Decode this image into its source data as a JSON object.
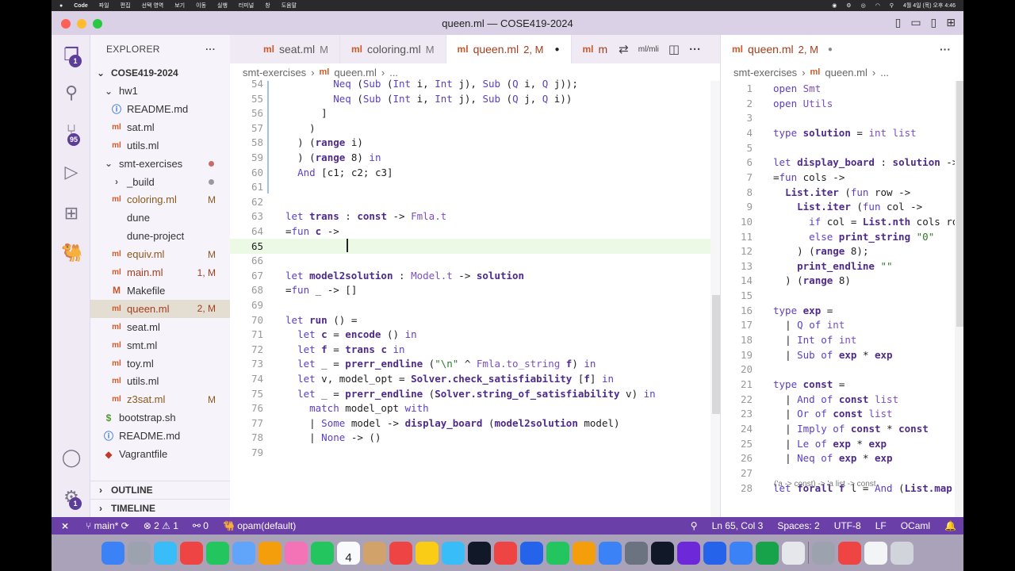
{
  "mac_menu": {
    "app": "Code",
    "items": [
      "파일",
      "편집",
      "선택 영역",
      "보기",
      "이동",
      "실행",
      "터미널",
      "창",
      "도움말"
    ],
    "clock": "4월 4일 (목) 오후 4:46"
  },
  "window": {
    "title": "queen.ml — COSE419-2024"
  },
  "activity": {
    "explorer_badge": "1",
    "scm_badge": "95",
    "settings_badge": "1"
  },
  "sidebar": {
    "header": "EXPLORER",
    "root": "COSE419-2024",
    "outline": "OUTLINE",
    "timeline": "TIMELINE",
    "items": [
      {
        "label": "hw1",
        "icon": "⌄",
        "status": ""
      },
      {
        "label": "README.md",
        "icon": "ⓘ",
        "status": ""
      },
      {
        "label": "sat.ml",
        "icon": "ml",
        "status": ""
      },
      {
        "label": "utils.ml",
        "icon": "ml",
        "status": ""
      },
      {
        "label": "smt-exercises",
        "icon": "⌄",
        "status": "dot"
      },
      {
        "label": "_build",
        "icon": "›",
        "status": "dot"
      },
      {
        "label": "coloring.ml",
        "icon": "ml",
        "status": "M"
      },
      {
        "label": "dune",
        "icon": "",
        "status": ""
      },
      {
        "label": "dune-project",
        "icon": "",
        "status": ""
      },
      {
        "label": "equiv.ml",
        "icon": "ml",
        "status": "M"
      },
      {
        "label": "main.ml",
        "icon": "ml",
        "status": "1, M"
      },
      {
        "label": "Makefile",
        "icon": "M",
        "status": ""
      },
      {
        "label": "queen.ml",
        "icon": "ml",
        "status": "2, M"
      },
      {
        "label": "seat.ml",
        "icon": "ml",
        "status": ""
      },
      {
        "label": "smt.ml",
        "icon": "ml",
        "status": ""
      },
      {
        "label": "toy.ml",
        "icon": "ml",
        "status": ""
      },
      {
        "label": "utils.ml",
        "icon": "ml",
        "status": ""
      },
      {
        "label": "z3sat.ml",
        "icon": "ml",
        "status": "M"
      },
      {
        "label": "bootstrap.sh",
        "icon": "$",
        "status": ""
      },
      {
        "label": "README.md",
        "icon": "ⓘ",
        "status": ""
      },
      {
        "label": "Vagrantfile",
        "icon": "◆",
        "status": ""
      }
    ]
  },
  "editor1": {
    "tabs": [
      {
        "label": "seat.ml",
        "mod": "M"
      },
      {
        "label": "coloring.ml",
        "mod": "M"
      },
      {
        "label": "queen.ml",
        "mod": "2, M"
      },
      {
        "label": "m",
        "mod": ""
      }
    ],
    "breadcrumb": [
      "smt-exercises",
      "queen.ml",
      "..."
    ],
    "lines": [
      {
        "n": "54",
        "t": "        Neq (Sub (Int i, Int j), Sub (Q i, Q j));"
      },
      {
        "n": "55",
        "t": "        Neq (Sub (Int i, Int j), Sub (Q j, Q i))"
      },
      {
        "n": "56",
        "t": "      ]"
      },
      {
        "n": "57",
        "t": "    )"
      },
      {
        "n": "58",
        "t": "  ) (range i)"
      },
      {
        "n": "59",
        "t": "  ) (range 8) in"
      },
      {
        "n": "60",
        "t": "  And [c1; c2; c3]"
      },
      {
        "n": "61",
        "t": ""
      },
      {
        "n": "62",
        "t": ""
      },
      {
        "n": "63",
        "t": "let trans : const -> Fmla.t"
      },
      {
        "n": "64",
        "t": "=fun c ->"
      },
      {
        "n": "65",
        "t": ""
      },
      {
        "n": "66",
        "t": ""
      },
      {
        "n": "67",
        "t": "let model2solution : Model.t -> solution"
      },
      {
        "n": "68",
        "t": "=fun _ -> []"
      },
      {
        "n": "69",
        "t": ""
      },
      {
        "n": "70",
        "t": "let run () ="
      },
      {
        "n": "71",
        "t": "  let c = encode () in"
      },
      {
        "n": "72",
        "t": "  let f = trans c in"
      },
      {
        "n": "73",
        "t": "  let _ = prerr_endline (\"\\n\" ^ Fmla.to_string f) in"
      },
      {
        "n": "74",
        "t": "  let v, model_opt = Solver.check_satisfiability [f] in"
      },
      {
        "n": "75",
        "t": "  let _ = prerr_endline (Solver.string_of_satisfiability v) in"
      },
      {
        "n": "76",
        "t": "    match model_opt with"
      },
      {
        "n": "77",
        "t": "    | Some model -> display_board (model2solution model)"
      },
      {
        "n": "78",
        "t": "    | None -> ()"
      },
      {
        "n": "79",
        "t": ""
      }
    ]
  },
  "editor2": {
    "tab": {
      "label": "queen.ml",
      "mod": "2, M"
    },
    "breadcrumb": [
      "smt-exercises",
      "queen.ml",
      "..."
    ],
    "hint": "('a -> const) -> 'a list -> const",
    "lines": [
      {
        "n": "1",
        "t": "open Smt"
      },
      {
        "n": "2",
        "t": "open Utils"
      },
      {
        "n": "3",
        "t": ""
      },
      {
        "n": "4",
        "t": "type solution = int list"
      },
      {
        "n": "5",
        "t": ""
      },
      {
        "n": "6",
        "t": "let display_board : solution ->"
      },
      {
        "n": "7",
        "t": "=fun cols ->"
      },
      {
        "n": "8",
        "t": "  List.iter (fun row ->"
      },
      {
        "n": "9",
        "t": "    List.iter (fun col ->"
      },
      {
        "n": "10",
        "t": "      if col = List.nth cols row"
      },
      {
        "n": "11",
        "t": "      else print_string \"0\""
      },
      {
        "n": "12",
        "t": "    ) (range 8);"
      },
      {
        "n": "13",
        "t": "    print_endline \"\""
      },
      {
        "n": "14",
        "t": "  ) (range 8)"
      },
      {
        "n": "15",
        "t": ""
      },
      {
        "n": "16",
        "t": "type exp ="
      },
      {
        "n": "17",
        "t": "  | Q of int"
      },
      {
        "n": "18",
        "t": "  | Int of int"
      },
      {
        "n": "19",
        "t": "  | Sub of exp * exp"
      },
      {
        "n": "20",
        "t": ""
      },
      {
        "n": "21",
        "t": "type const ="
      },
      {
        "n": "22",
        "t": "  | And of const list"
      },
      {
        "n": "23",
        "t": "  | Or of const list"
      },
      {
        "n": "24",
        "t": "  | Imply of const * const"
      },
      {
        "n": "25",
        "t": "  | Le of exp * exp"
      },
      {
        "n": "26",
        "t": "  | Neq of exp * exp"
      },
      {
        "n": "27",
        "t": ""
      },
      {
        "n": "28",
        "t": "let forall f l = And (List.map f"
      }
    ]
  },
  "status": {
    "remote": "⨯",
    "branch": "main*",
    "errors": "2",
    "warnings": "1",
    "ports": "0",
    "opam": "opam(default)",
    "position": "Ln 65, Col 3",
    "spaces": "Spaces: 2",
    "encoding": "UTF-8",
    "eol": "LF",
    "language": "OCaml"
  },
  "dock": {
    "calendar_day": "4",
    "colors": [
      "#3b82f6",
      "#9ca3af",
      "#38bdf8",
      "#ef4444",
      "#22c55e",
      "#60a5fa",
      "#f59e0b",
      "#f472b6",
      "#22c55e",
      "#f8fafc",
      "#d1a36b",
      "#ef4444",
      "#facc15",
      "#38bdf8",
      "#111827",
      "#ef4444",
      "#2563eb",
      "#22c55e",
      "#f59e0b",
      "#3b82f6",
      "#6b7280",
      "#111827",
      "#6d28d9",
      "#2563eb",
      "#3b82f6",
      "#16a34a",
      "#e5e7eb",
      "#9ca3af",
      "#ef4444",
      "#f3f4f6",
      "#d1d5db"
    ]
  }
}
